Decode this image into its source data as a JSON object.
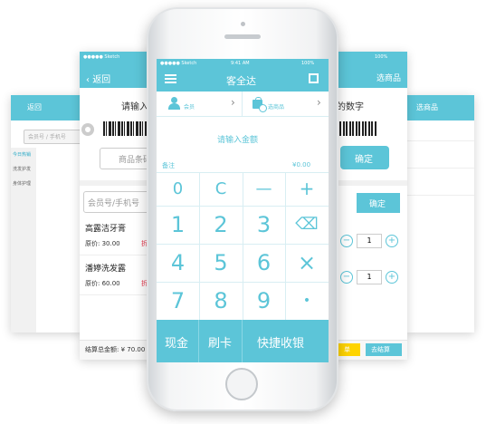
{
  "far_left": {
    "back": "返回",
    "search_placeholder": "会员号 / 手机号",
    "cats": [
      "今日热销",
      "洗发护发",
      "身体护理"
    ]
  },
  "far_right": {
    "title": "选商品"
  },
  "left": {
    "status_carrier": "●●●●● Sketch",
    "back": "返回",
    "prompt": "请输入",
    "product_input": "商品条码",
    "member_input": "会员号/手机号",
    "items": [
      {
        "name": "高露洁牙膏",
        "price": "原价: 30.00",
        "discount": "折扣"
      },
      {
        "name": "潘婷洗发露",
        "price": "原价: 60.00",
        "discount": "折扣"
      }
    ],
    "total": "结算总金额: ¥ 70.00"
  },
  "right": {
    "status_battery": "100%",
    "title": "选商品",
    "prompt": "的数字",
    "confirm1": "确定",
    "confirm2": "确定",
    "qty1": "1",
    "qty2": "1",
    "btn_yellow": "单",
    "btn_checkout": "去结算"
  },
  "phone": {
    "status_carrier": "●●●●● Sketch",
    "status_time": "9:41 AM",
    "status_battery": "100%",
    "title": "客全达",
    "member_tab": "会员",
    "goods_tab": "选商品",
    "amount_prompt": "请输入金额",
    "note_label": "备注",
    "amount_value": "¥0.00",
    "keys": [
      "0",
      "C",
      "—",
      "+",
      "1",
      "2",
      "3",
      "⌫",
      "4",
      "5",
      "6",
      "×",
      "7",
      "8",
      "9",
      "•"
    ],
    "bottom": [
      "现金",
      "刷卡",
      "快捷收银"
    ]
  },
  "colors": {
    "accent": "#5cc5d8",
    "yellow": "#ffd400",
    "red": "#e8344a"
  }
}
